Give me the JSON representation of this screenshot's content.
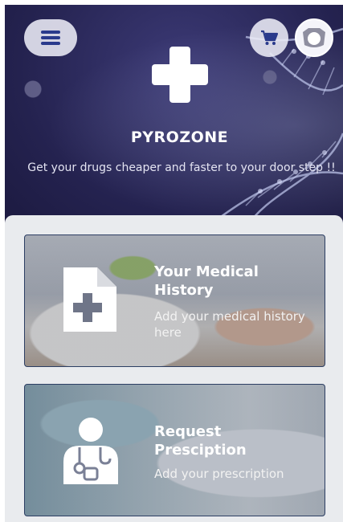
{
  "header": {
    "brand": "PYROZONE",
    "tagline": "Get your drugs cheaper and faster to your door step !!",
    "menu_icon": "menu-icon",
    "cart_icon": "cart-icon",
    "avatar_icon": "user-avatar-icon"
  },
  "cards": [
    {
      "title": "Your Medical History",
      "subtitle": "Add your medical history here",
      "icon": "medical-document-icon"
    },
    {
      "title": "Request Presciption",
      "subtitle": "Add your prescription",
      "icon": "doctor-icon"
    }
  ],
  "colors": {
    "hero_bg": "#24224f",
    "accent": "#2a3a8c",
    "card_border": "#2c3e63",
    "panel_bg": "#e9ebee"
  }
}
